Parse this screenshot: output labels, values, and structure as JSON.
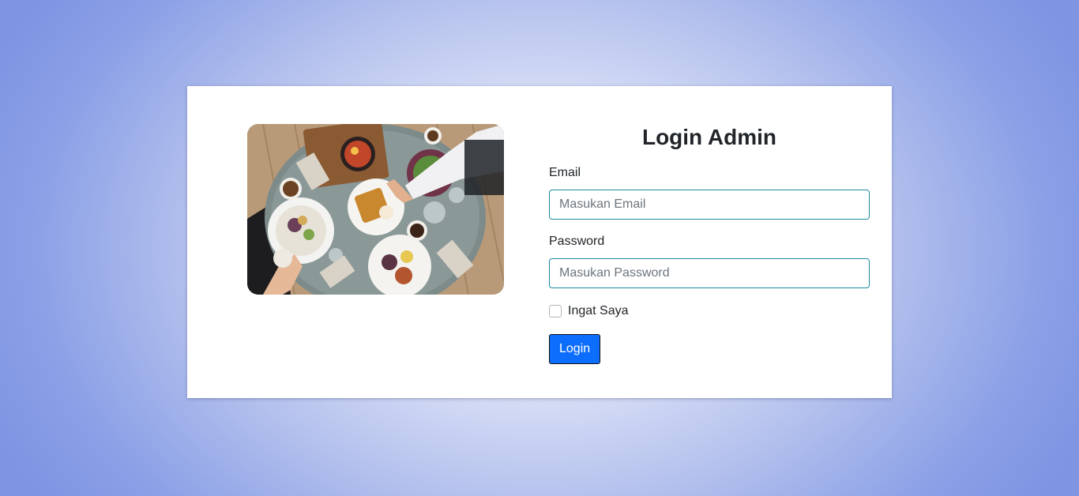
{
  "page": {
    "background_color_center": "#ffffff",
    "background_color_edge": "#7f95e2"
  },
  "image": {
    "subject": "food-table-photo"
  },
  "login": {
    "title": "Login Admin",
    "email_label": "Email",
    "email_placeholder": "Masukan Email",
    "email_value": "",
    "password_label": "Password",
    "password_placeholder": "Masukan Password",
    "password_value": "",
    "remember_label": "Ingat Saya",
    "remember_checked": false,
    "submit_label": "Login",
    "accent_color": "#0d6efd",
    "input_border_color": "#1e8aa0"
  }
}
